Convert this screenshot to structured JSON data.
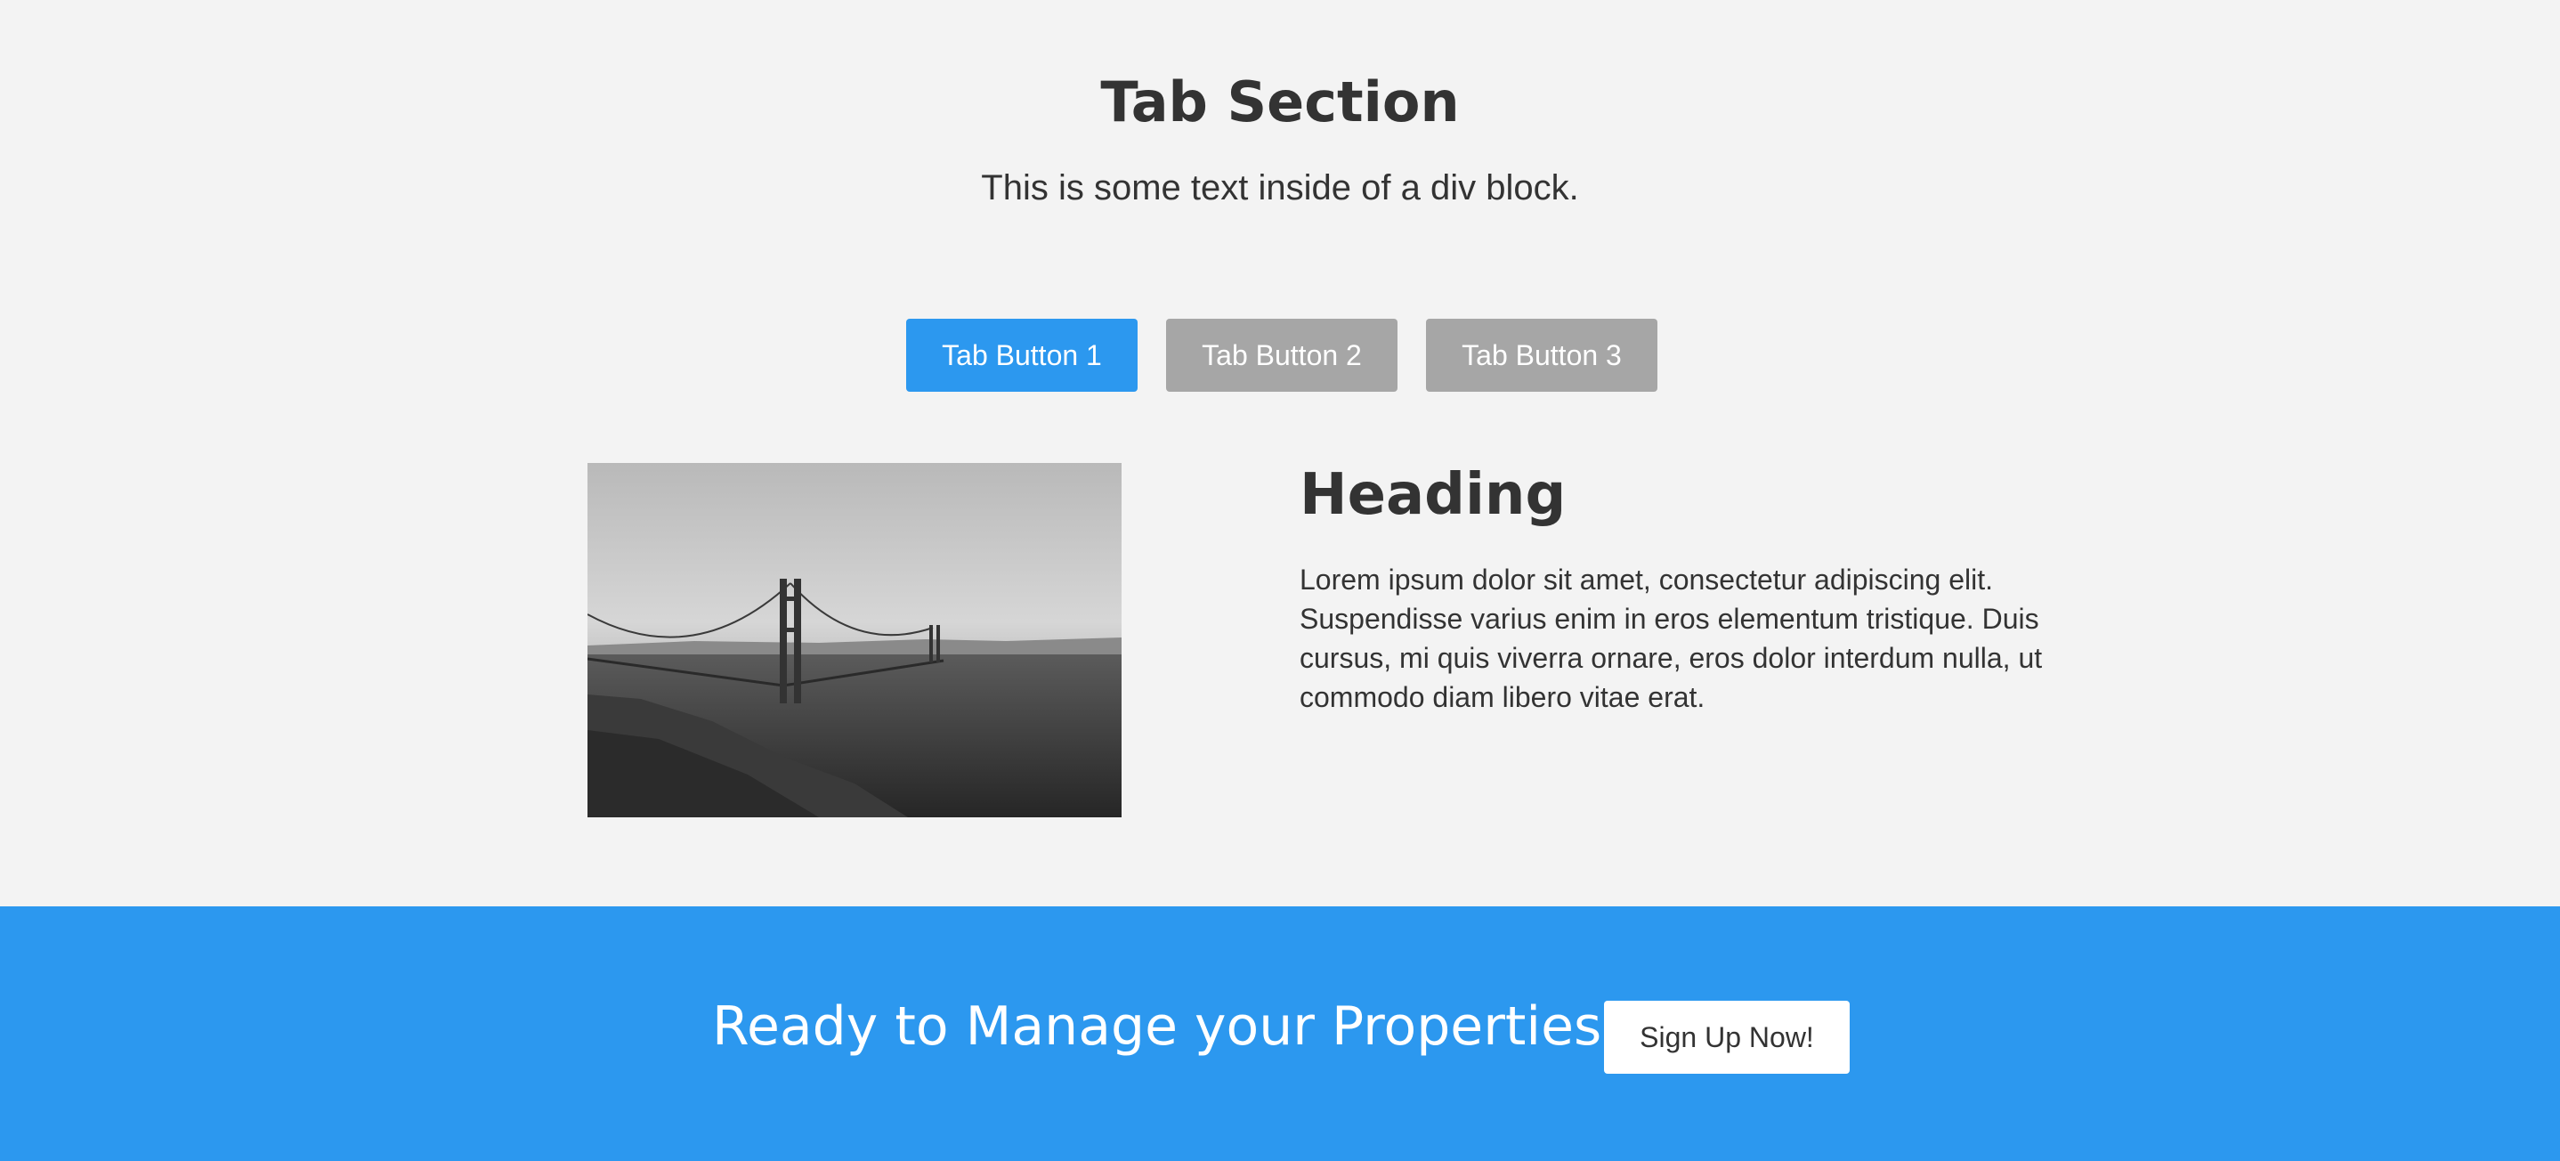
{
  "section": {
    "title": "Tab Section",
    "subtitle": "This is some text inside of a div block."
  },
  "tabs": [
    {
      "label": "Tab Button 1",
      "active": true
    },
    {
      "label": "Tab Button 2",
      "active": false
    },
    {
      "label": "Tab Button 3",
      "active": false
    }
  ],
  "tab_content": {
    "image_icon": "golden-gate-bridge-photo",
    "heading": "Heading",
    "text": "Lorem ipsum dolor sit amet, consectetur adipiscing elit. Suspendisse varius enim in eros elementum tristique. Duis cursus, mi quis viverra ornare, eros dolor interdum nulla, ut commodo diam libero vitae erat."
  },
  "cta": {
    "text": "Ready to Manage your Properties?",
    "button_label": "Sign Up Now!"
  },
  "colors": {
    "accent": "#2c98ef",
    "tab_inactive": "#a6a6a6",
    "background": "#f3f3f3",
    "text": "#333333"
  }
}
